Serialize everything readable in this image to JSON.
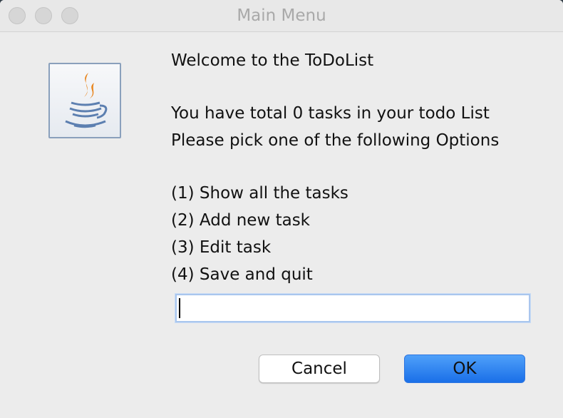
{
  "window": {
    "title": "Main Menu"
  },
  "icon": {
    "name": "java-icon"
  },
  "message": {
    "welcome": "Welcome to the ToDoList",
    "total_tasks": "You have total 0 tasks in your todo List",
    "prompt": "Please pick one of the following Options",
    "options": [
      "(1) Show all the tasks",
      "(2) Add new task",
      "(3) Edit task",
      "(4) Save and quit"
    ]
  },
  "input": {
    "value": ""
  },
  "buttons": {
    "cancel_label": "Cancel",
    "ok_label": "OK"
  },
  "colors": {
    "accent": "#1a6fe8",
    "window_bg": "#ececec"
  }
}
